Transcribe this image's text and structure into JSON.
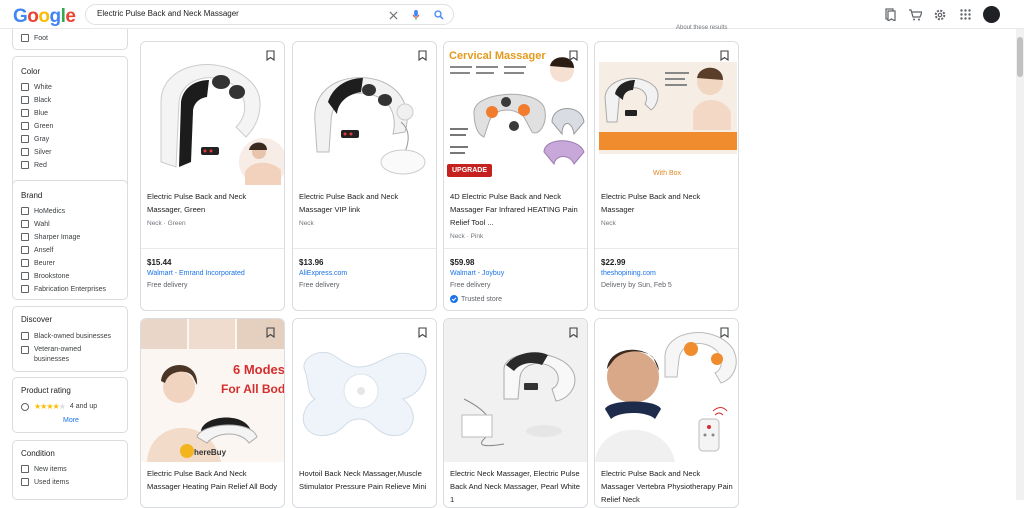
{
  "header": {
    "logo_letters": [
      "G",
      "o",
      "o",
      "g",
      "l",
      "e"
    ],
    "search_query": "Electric Pulse Back and Neck Massager",
    "icons": [
      "close-icon",
      "mic-icon",
      "search-icon",
      "bookmarks-icon",
      "cart-icon",
      "settings-icon",
      "apps-grid-icon"
    ]
  },
  "about_results": "About these results",
  "filters": {
    "partial_option": "Foot",
    "color": {
      "title": "Color",
      "options": [
        "White",
        "Black",
        "Blue",
        "Green",
        "Gray",
        "Silver",
        "Red"
      ]
    },
    "brand": {
      "title": "Brand",
      "options": [
        "HoMedics",
        "Wahl",
        "Sharper Image",
        "Anself",
        "Beurer",
        "Brookstone",
        "Fabrication Enterprises"
      ]
    },
    "discover": {
      "title": "Discover",
      "options": [
        "Black-owned businesses",
        "Veteran-owned businesses"
      ]
    },
    "rating": {
      "title": "Product rating",
      "label": "4 and up",
      "stars": 4,
      "more": "More"
    },
    "condition": {
      "title": "Condition",
      "options": [
        "New items",
        "Used items"
      ]
    }
  },
  "products": [
    {
      "title": "Electric Pulse Back and Neck Massager, Green",
      "sub": "Neck · Green",
      "price": "$15.44",
      "store": "Walmart - Emrand Incorporated",
      "delivery": "Free delivery",
      "trusted": "",
      "badge": ""
    },
    {
      "title": "Electric Pulse Back and Neck Massager VIP link",
      "sub": "Neck",
      "price": "$13.96",
      "store": "AliExpress.com",
      "delivery": "Free delivery",
      "trusted": "",
      "badge": ""
    },
    {
      "title": "4D Electric Pulse Back and Neck Massager Far Infrared HEATING Pain Relief Tool ...",
      "sub": "Neck · Pink",
      "price": "$59.98",
      "store": "Walmart - Joybuy",
      "delivery": "Free delivery",
      "trusted": "Trusted store",
      "badge": "UPGRADE",
      "img_text": "Cervical Massager"
    },
    {
      "title": "Electric Pulse Back and Neck Massager",
      "sub": "Neck",
      "price": "$22.99",
      "store": "theshopining.com",
      "delivery": "Delivery by Sun, Feb 5",
      "trusted": "",
      "badge": "",
      "img_text": "With Box"
    },
    {
      "title": "Electric Pulse Back And Neck Massager Heating Pain Relief All Body",
      "img_text": "6 Modes For All Body",
      "img_text2": "hereBuy"
    },
    {
      "title": "Hovtoil Back Neck Massager,Muscle Stimulator Pressure Pain Relieve Mini"
    },
    {
      "title": "Electric Neck Massager, Electric Pulse Back And Neck Massager, Pearl White 1"
    },
    {
      "title": "Electric Pulse Back and Neck Massager Vertebra Physiotherapy Pain Relief Neck"
    }
  ]
}
